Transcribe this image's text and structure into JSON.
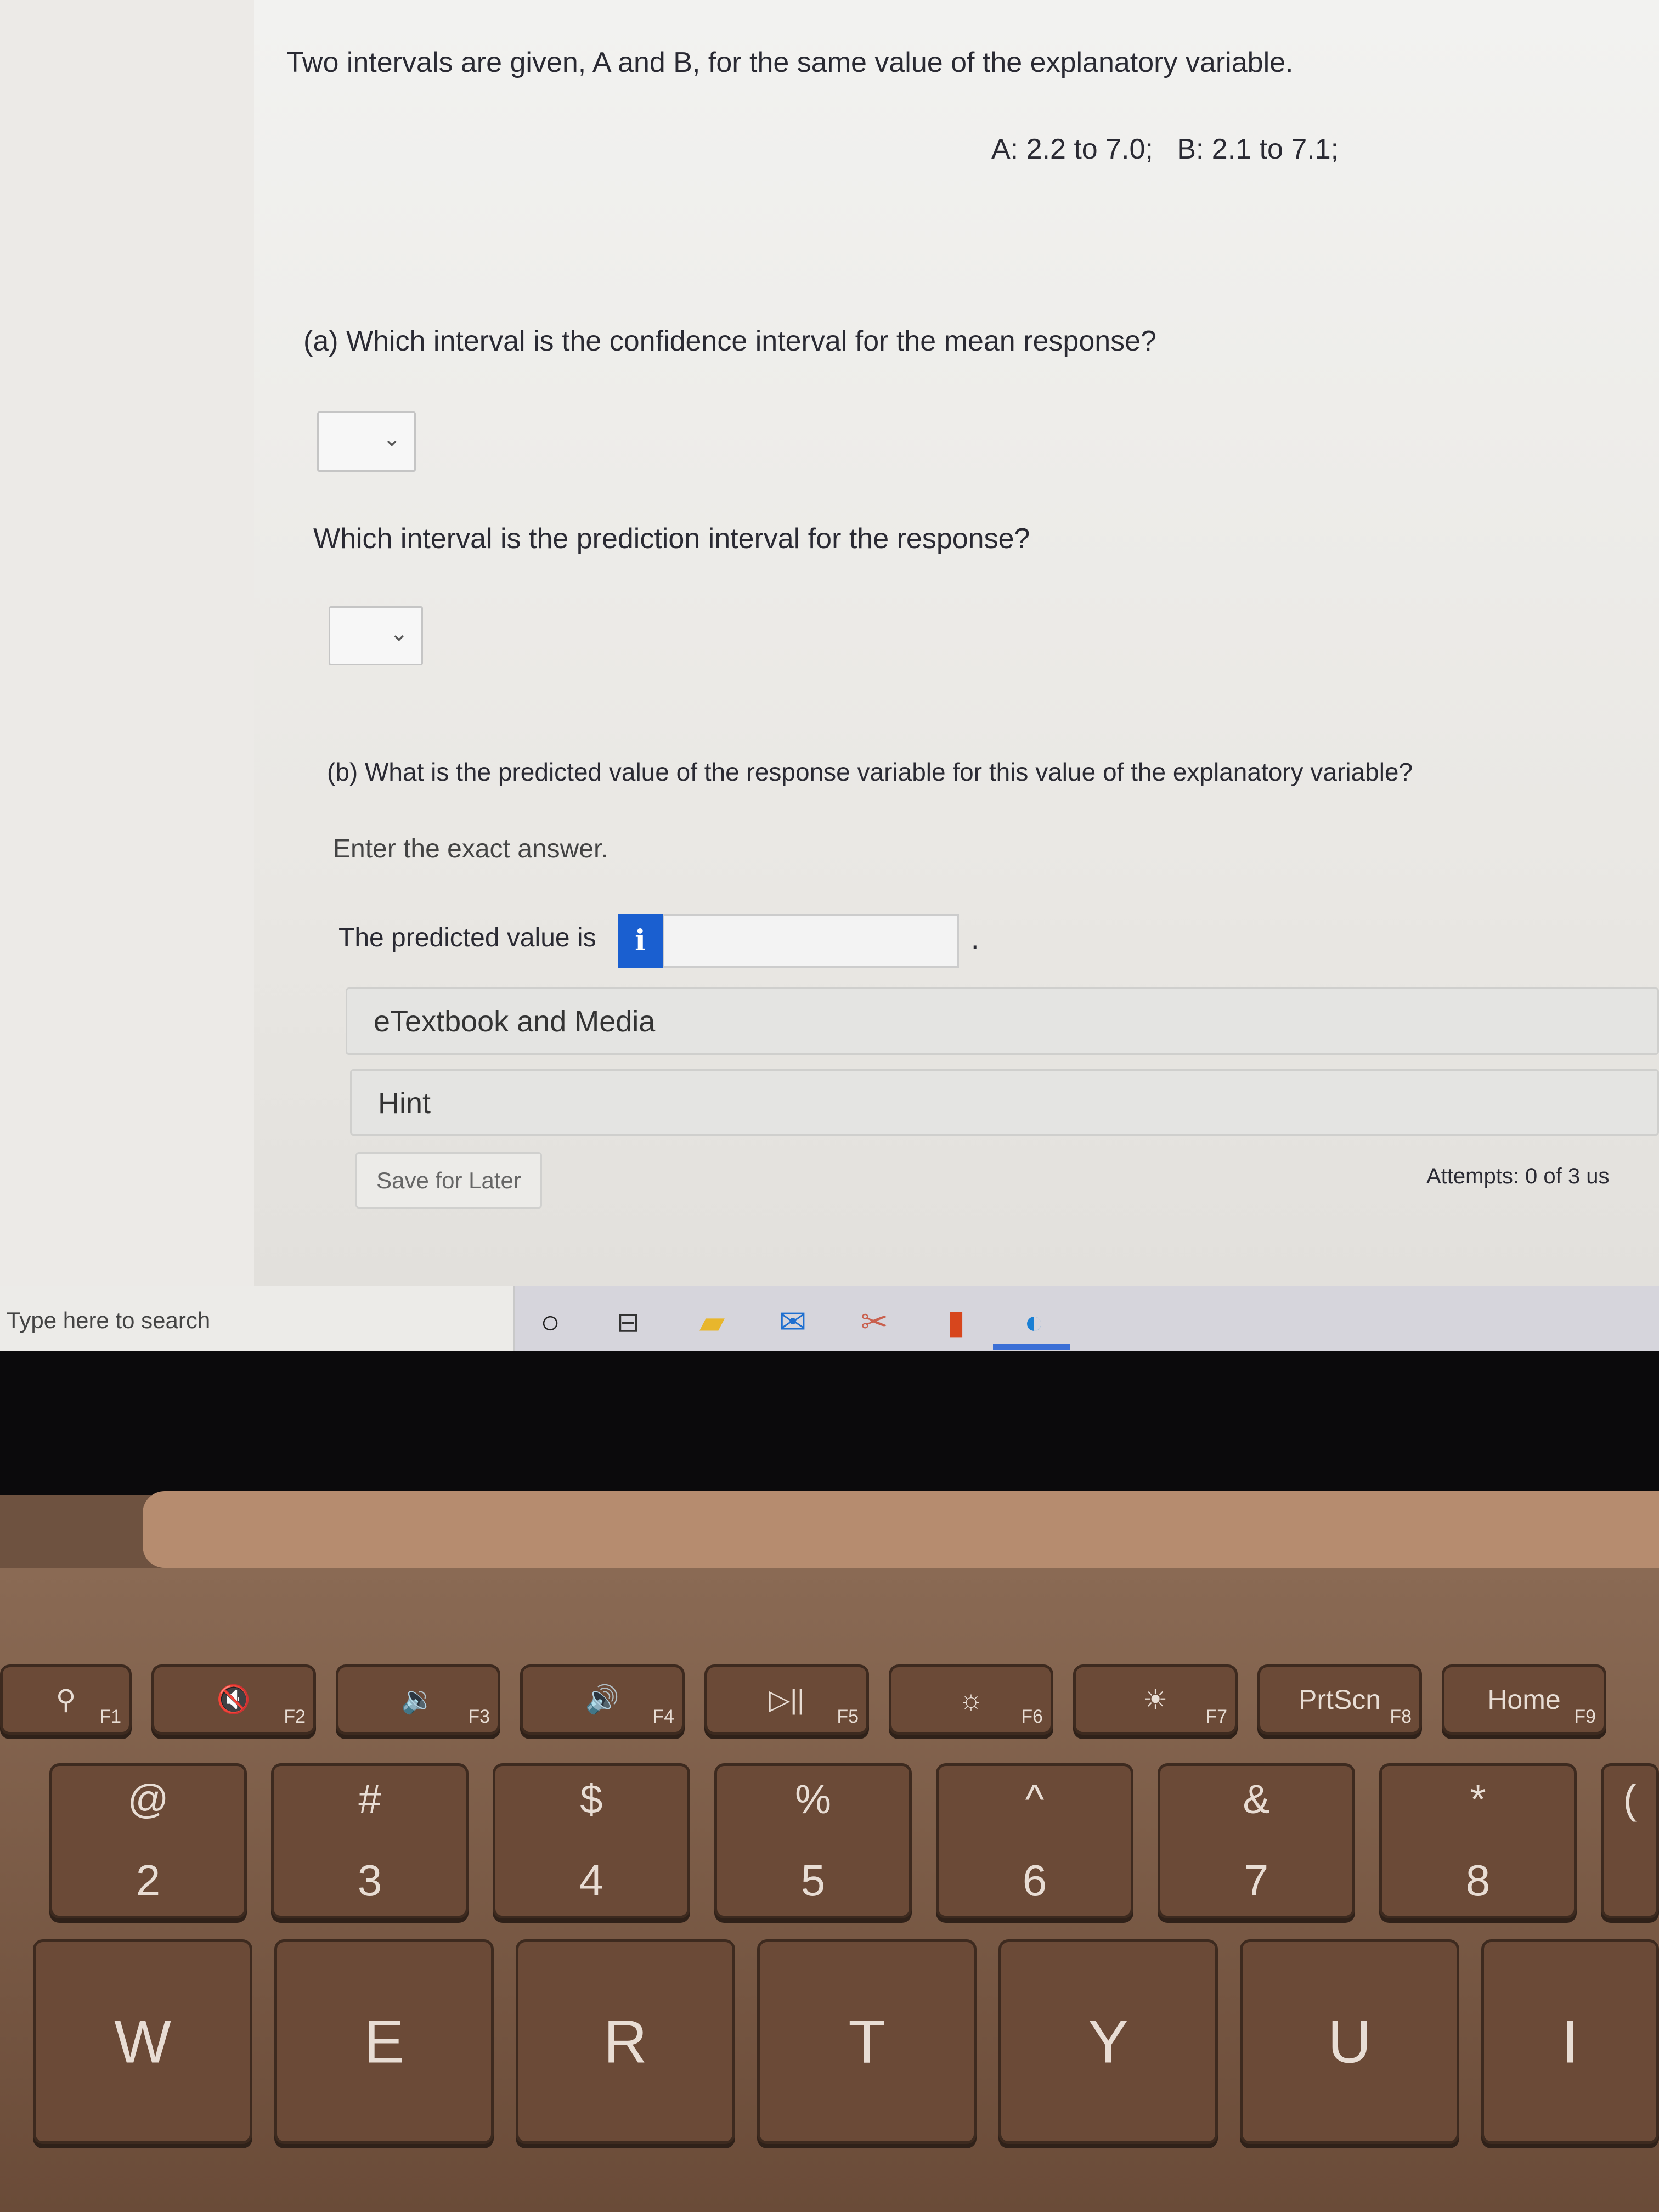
{
  "question": {
    "intro": "Two intervals are given, A and B, for the same value of the explanatory variable.",
    "intervals": "A: 2.2 to 7.0;   B: 2.1 to 7.1;",
    "part_a": "(a) Which interval is the confidence interval for the mean response?",
    "dropdown_a": "",
    "part_a2": "Which interval is the prediction interval for the response?",
    "dropdown_b": "",
    "part_b": "(b) What is the predicted value of the response variable for this value of the explanatory variable?",
    "instruction": "Enter the exact answer.",
    "predicted_label": "The predicted value is",
    "info_label": "i",
    "predicted_value": "",
    "period": "."
  },
  "resources": {
    "etextbook": "eTextbook and Media",
    "hint": "Hint"
  },
  "actions": {
    "save_later": "Save for Later",
    "attempts": "Attempts: 0 of 3 us"
  },
  "taskbar": {
    "search_placeholder": "Type here to search",
    "icons": [
      "cortana-icon",
      "task-view-icon",
      "file-explorer-icon",
      "mail-icon",
      "snipping-tool-icon",
      "office-icon",
      "edge-icon"
    ]
  },
  "keyboard": {
    "fkeys": [
      {
        "glyph": "⚲",
        "label": "F1"
      },
      {
        "glyph": "🔇",
        "label": "F2"
      },
      {
        "glyph": "🔉",
        "label": "F3"
      },
      {
        "glyph": "🔊",
        "label": "F4"
      },
      {
        "glyph": "▷||",
        "label": "F5"
      },
      {
        "glyph": "☼",
        "label": "F6"
      },
      {
        "glyph": "☀",
        "label": "F7"
      },
      {
        "glyph": "PrtScn",
        "label": "F8"
      },
      {
        "glyph": "Home",
        "label": "F9"
      }
    ],
    "numbers": [
      {
        "top": "@",
        "bot": "2"
      },
      {
        "top": "#",
        "bot": "3"
      },
      {
        "top": "$",
        "bot": "4"
      },
      {
        "top": "%",
        "bot": "5"
      },
      {
        "top": "^",
        "bot": "6"
      },
      {
        "top": "&",
        "bot": "7"
      },
      {
        "top": "*",
        "bot": "8"
      },
      {
        "top": "(",
        "bot": ""
      }
    ],
    "letters": [
      "W",
      "E",
      "R",
      "T",
      "Y",
      "U",
      "I"
    ]
  },
  "colors": {
    "info_button": "#1a5fd0",
    "keys": "#6b4a37",
    "taskbar": "#d6d5dc"
  }
}
